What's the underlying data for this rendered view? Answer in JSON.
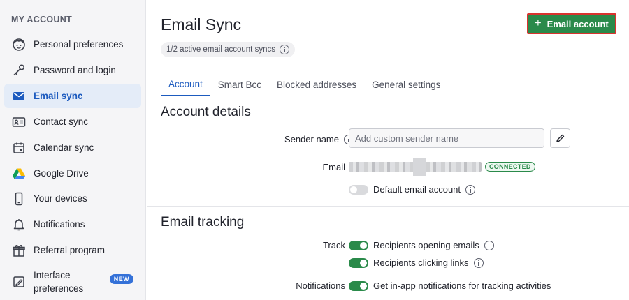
{
  "sidebar": {
    "heading": "MY ACCOUNT",
    "items": [
      {
        "label": "Personal preferences",
        "icon": "face-icon"
      },
      {
        "label": "Password and login",
        "icon": "key-icon"
      },
      {
        "label": "Email sync",
        "icon": "envelope-icon",
        "active": true
      },
      {
        "label": "Contact sync",
        "icon": "contact-card-icon"
      },
      {
        "label": "Calendar sync",
        "icon": "calendar-icon"
      },
      {
        "label": "Google Drive",
        "icon": "google-drive-icon"
      },
      {
        "label": "Your devices",
        "icon": "phone-icon"
      },
      {
        "label": "Notifications",
        "icon": "bell-icon"
      },
      {
        "label": "Referral program",
        "icon": "gift-icon"
      },
      {
        "label_line1": "Interface",
        "label_line2": "preferences",
        "icon": "interface-icon",
        "badge": "NEW"
      }
    ]
  },
  "header": {
    "title": "Email Sync",
    "sync_status": "1/2 active email account syncs",
    "add_button": "Email account"
  },
  "tabs": [
    "Account",
    "Smart Bcc",
    "Blocked addresses",
    "General settings"
  ],
  "account_details": {
    "title": "Account details",
    "sender_label": "Sender name",
    "sender_placeholder": "Add custom sender name",
    "email_label": "Email",
    "connected_badge": "CONNECTED",
    "default_label": "Default email account",
    "default_enabled": false
  },
  "email_tracking": {
    "title": "Email tracking",
    "track_label": "Track",
    "opening_label": "Recipients opening emails",
    "clicking_label": "Recipients clicking links",
    "notifications_label": "Notifications",
    "notifications_text": "Get in-app notifications for tracking activities",
    "opening_enabled": true,
    "clicking_enabled": true,
    "notifications_enabled": true
  },
  "colors": {
    "primary_green": "#2a8a4a",
    "active_blue": "#1d5bbf",
    "highlight_red": "#d9332f"
  }
}
